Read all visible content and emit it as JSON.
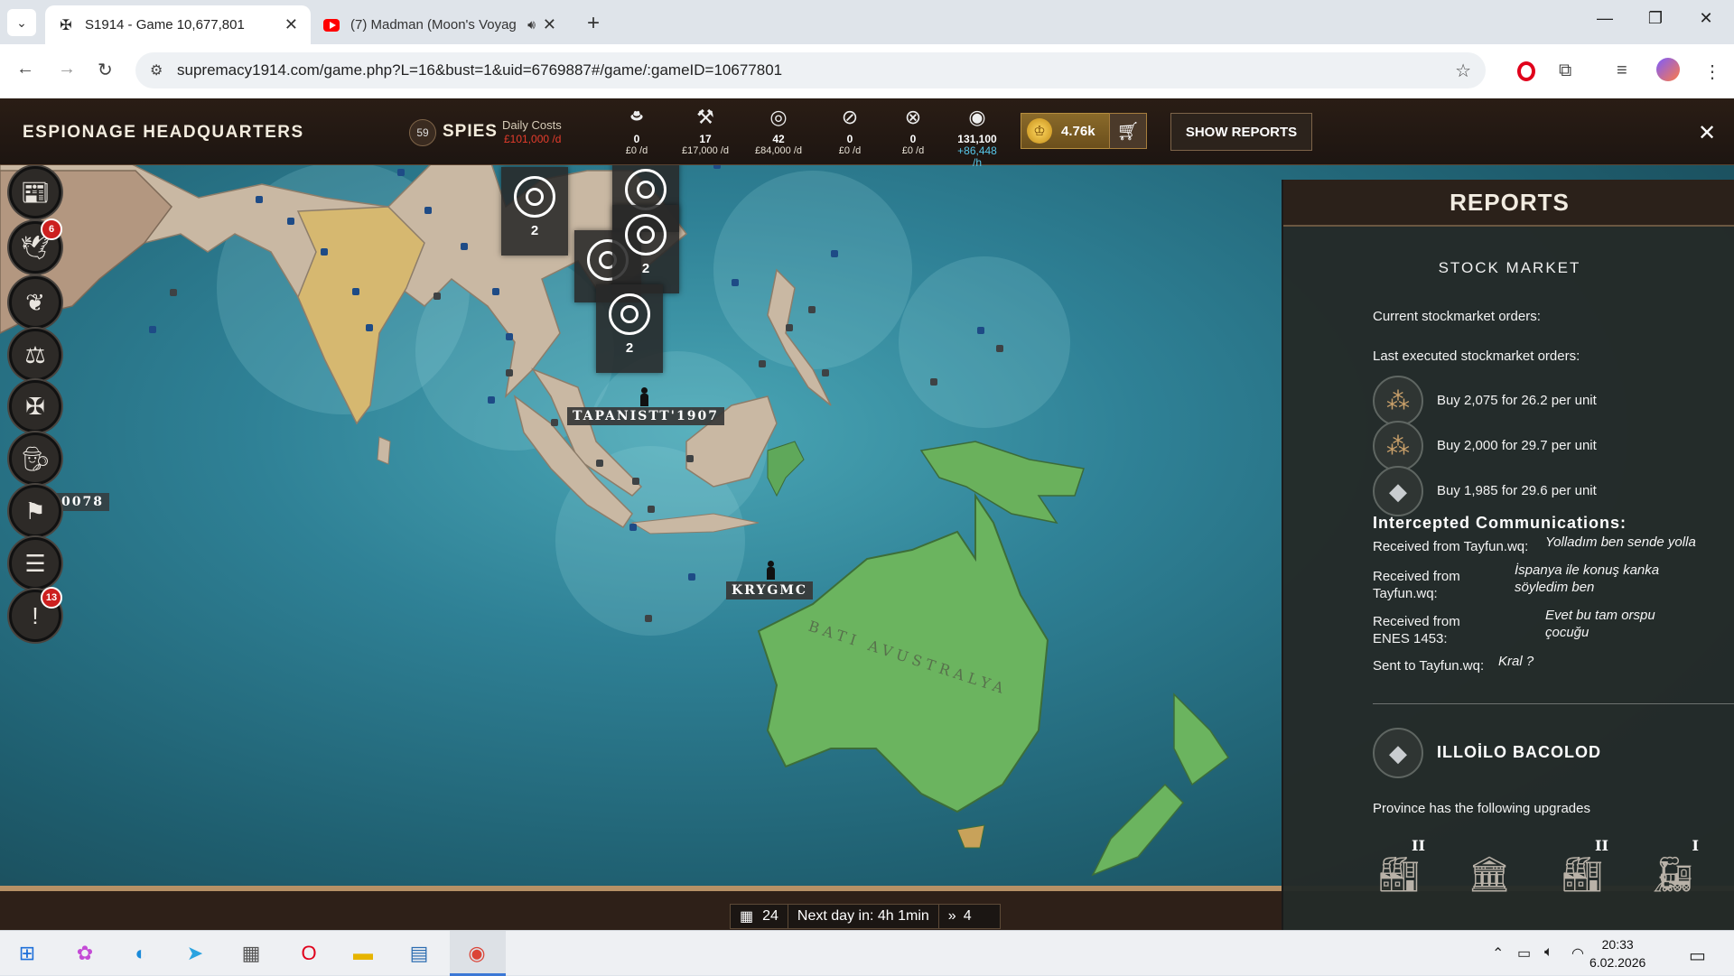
{
  "browser": {
    "tabs": [
      {
        "title": "S1914 - Game 10,677,801",
        "active": true
      },
      {
        "title": "(7) Madman (Moon's Voyag",
        "active": false
      }
    ],
    "url": "supremacy1914.com/game.php?L=16&bust=1&uid=6769887#/game/:gameID=10677801"
  },
  "game": {
    "title": "ESPIONAGE HEADQUARTERS",
    "spies_count": "59",
    "spies_label": "SPIES",
    "daily_costs_label": "Daily Costs",
    "daily_costs_value": "£101,000 /d",
    "resources": [
      {
        "icon": "spy-hat-icon",
        "value": "0",
        "cost": "£0 /d"
      },
      {
        "icon": "sabotage-icon",
        "value": "17",
        "cost": "£17,000 /d"
      },
      {
        "icon": "target-icon",
        "value": "42",
        "cost": "£84,000 /d"
      },
      {
        "icon": "no-economy-icon",
        "value": "0",
        "cost": "£0 /d"
      },
      {
        "icon": "no-troops-icon",
        "value": "0",
        "cost": "£0 /d"
      },
      {
        "icon": "money-icon",
        "value": "131,100",
        "cost": "+86,448",
        "rate": "/h"
      }
    ],
    "gold": "4.76k",
    "show_reports": "SHOW REPORTS",
    "cities": [
      "TAPANISTT'1907",
      "KRYGMC",
      "0078"
    ],
    "regions": [
      "BATI AVUSTRALYA"
    ],
    "spy_cards": [
      "2",
      "2",
      "2",
      "2",
      ""
    ],
    "sidebar_badges": {
      "diplomacy": "6",
      "alerts": "13"
    },
    "bottom": {
      "day": "24",
      "next_day": "Next day in: 4h 1min",
      "speed": "4"
    }
  },
  "reports": {
    "title": "REPORTS",
    "stock_market": "STOCK MARKET",
    "current_orders": "Current stockmarket orders:",
    "last_orders": "Last executed stockmarket orders:",
    "orders": [
      {
        "icon": "timber-icon",
        "text": "Buy 2,075 for 26.2 per unit"
      },
      {
        "icon": "timber-icon",
        "text": "Buy 2,000 for 29.7 per unit"
      },
      {
        "icon": "iron-icon",
        "text": "Buy 1,985 for 29.6 per unit"
      }
    ],
    "intercepted_title": "Intercepted Communications:",
    "messages": [
      {
        "from": "Received from Tayfun.wq:",
        "text": "Yolladım ben sende yolla"
      },
      {
        "from": "Received from Tayfun.wq:",
        "text": "İspanya ile konuş kanka söyledim ben"
      },
      {
        "from": "Received from ENES 1453:",
        "text": "Evet bu tam orspu çocuğu"
      },
      {
        "from": "Sent to Tayfun.wq:",
        "text": "Kral ?"
      }
    ],
    "province_name": "ILLOİLO BACOLOD",
    "province_text": "Province has the following upgrades",
    "upgrades": [
      {
        "name": "industrial-complex-icon",
        "level": "II"
      },
      {
        "name": "barracks-icon",
        "level": ""
      },
      {
        "name": "factory-icon",
        "level": "II"
      },
      {
        "name": "railway-icon",
        "level": "I"
      }
    ]
  },
  "taskbar": {
    "time": "20:33",
    "date": "6.02.2026"
  }
}
